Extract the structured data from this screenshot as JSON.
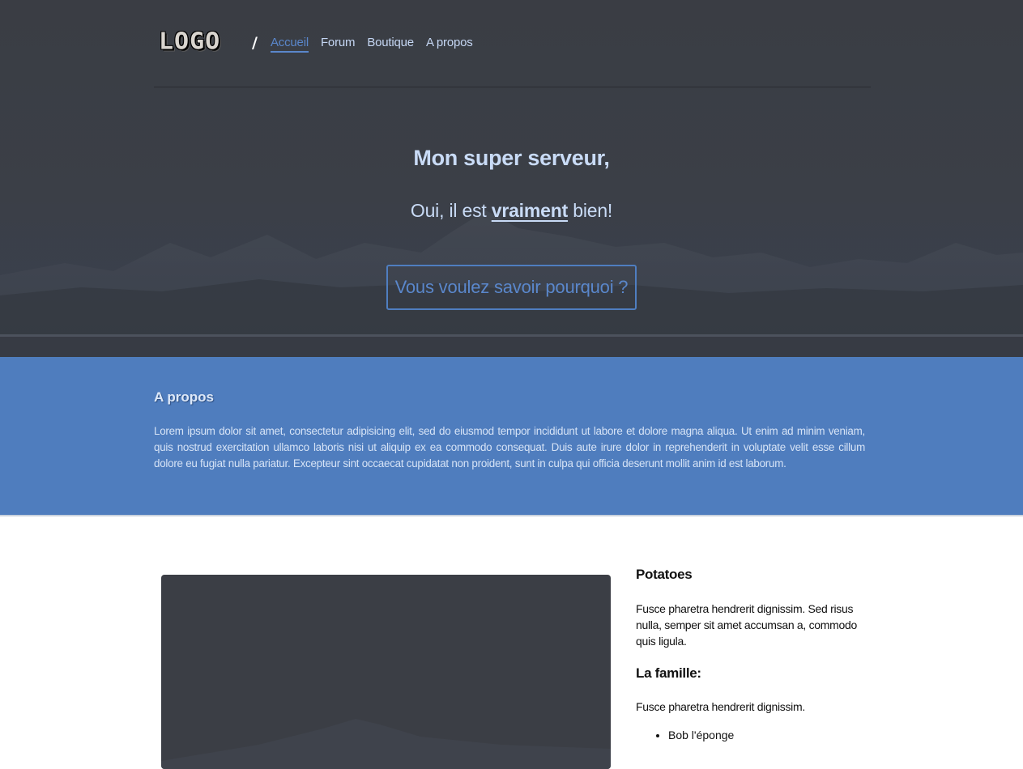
{
  "header": {
    "logo_text": "LOGO",
    "separator": "/",
    "nav": [
      {
        "label": "Accueil",
        "active": true
      },
      {
        "label": "Forum",
        "active": false
      },
      {
        "label": "Boutique",
        "active": false
      },
      {
        "label": "A propos",
        "active": false
      }
    ]
  },
  "hero": {
    "title": "Mon super serveur,",
    "subtitle_before": "Oui, il est ",
    "subtitle_emphasis": "vraiment",
    "subtitle_after": " bien!",
    "cta_label": "Vous voulez savoir pourquoi ?"
  },
  "about": {
    "title": "A propos",
    "text": "Lorem ipsum dolor sit amet, consectetur adipisicing elit, sed do eiusmod tempor incididunt ut labore et dolore magna aliqua. Ut enim ad minim veniam, quis nostrud exercitation ullamco laboris nisi ut aliquip ex ea commodo consequat. Duis aute irure dolor in reprehenderit in voluptate velit esse cillum dolore eu fugiat nulla pariatur. Excepteur sint occaecat cupidatat non proident, sunt in culpa qui officia deserunt mollit anim id est laborum."
  },
  "content": {
    "section1_title": "Potatoes",
    "section1_text": "Fusce pharetra hendrerit dignissim. Sed risus nulla, semper sit amet accumsan a, commodo quis ligula.",
    "section2_title": "La famille:",
    "section2_text": "Fusce pharetra hendrerit dignissim.",
    "list": [
      "Bob l'éponge"
    ]
  },
  "colors": {
    "hero_bg": "#3a3d44",
    "accent": "#5a87cb",
    "nav_text": "#c5d7f4",
    "about_bg": "#4f7dbe"
  }
}
